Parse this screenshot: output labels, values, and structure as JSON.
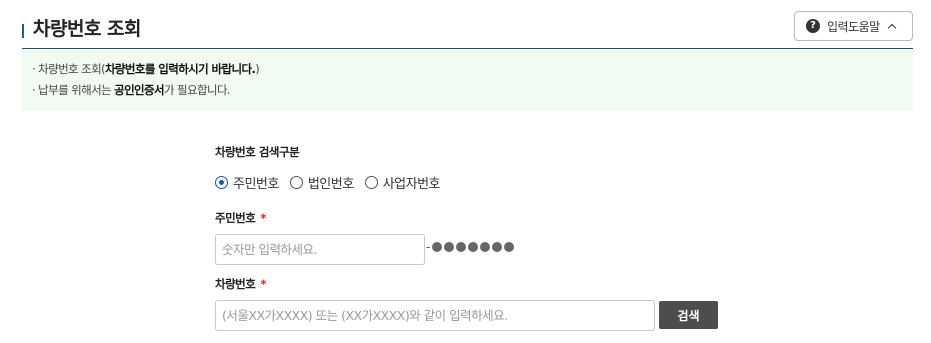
{
  "header": {
    "title": "차량번호 조회",
    "help_label": "입력도움말",
    "help_icon": "?"
  },
  "notice": {
    "line1_prefix": "· 차량번호 조회(",
    "line1_bold": "차량번호를 입력하시기 바랍니다.",
    "line1_suffix": ")",
    "line2_prefix": "· 납부를 위해서는 ",
    "line2_bold": "공인인증서",
    "line2_suffix": "가 필요합니다."
  },
  "form": {
    "search_type_label": "차량번호 검색구분",
    "options": [
      "주민번호",
      "법인번호",
      "사업자번호"
    ],
    "selected_option": "주민번호",
    "id_label": "주민번호",
    "required_mark": "*",
    "id_placeholder": "숫자만 입력하세요.",
    "id_value": "",
    "masked_dash": "-",
    "masked_count": 7,
    "plate_label": "차량번호",
    "plate_placeholder": "(서울XX가XXXX) 또는 (XX가XXXX)와 같이 입력하세요.",
    "plate_value": "",
    "search_button": "검색"
  },
  "colors": {
    "accent": "#1e5aa0",
    "header_rule": "#1b4f72",
    "notice_bg": "#f2fbf2",
    "required": "#e02020",
    "button_bg": "#4d4d4d"
  }
}
